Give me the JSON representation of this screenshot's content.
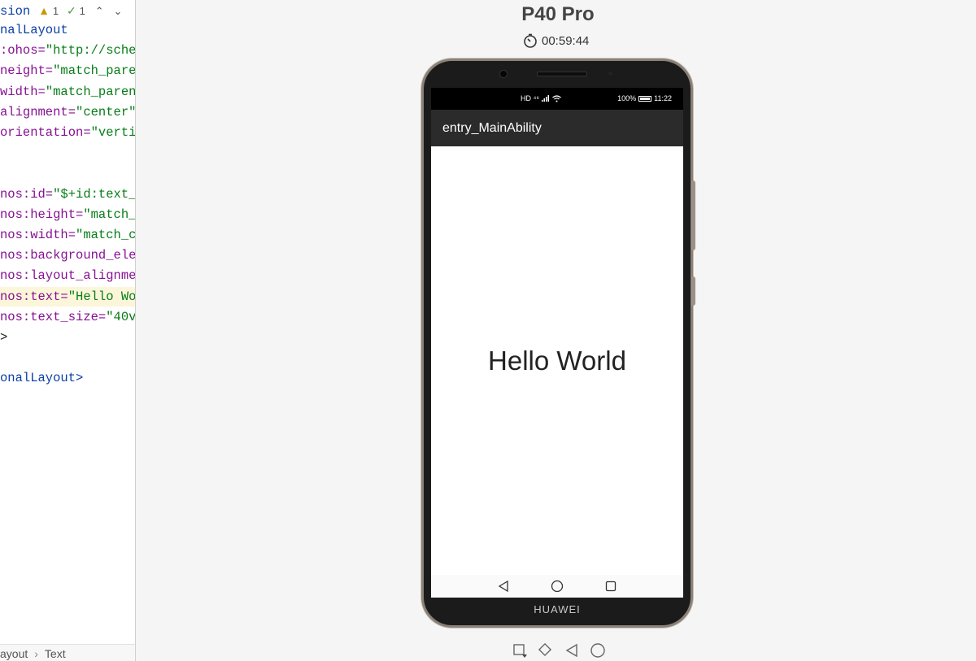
{
  "editor": {
    "status": {
      "context": "sion",
      "warnings": "1",
      "checks": "1"
    },
    "lines": [
      {
        "segments": [
          {
            "text": "nalLayout",
            "cls": "tag"
          }
        ]
      },
      {
        "segments": [
          {
            "text": ":ohos=",
            "cls": "attr"
          },
          {
            "text": "\"http://sche",
            "cls": "val"
          }
        ]
      },
      {
        "segments": [
          {
            "text": "neight=",
            "cls": "attr"
          },
          {
            "text": "\"match_pare",
            "cls": "val"
          }
        ]
      },
      {
        "segments": [
          {
            "text": "width=",
            "cls": "attr"
          },
          {
            "text": "\"match_paren",
            "cls": "val"
          }
        ]
      },
      {
        "segments": [
          {
            "text": "alignment=",
            "cls": "attr"
          },
          {
            "text": "\"center\"",
            "cls": "val"
          }
        ]
      },
      {
        "segments": [
          {
            "text": "orientation=",
            "cls": "attr"
          },
          {
            "text": "\"verti",
            "cls": "val"
          }
        ]
      },
      {
        "segments": []
      },
      {
        "segments": []
      },
      {
        "segments": [
          {
            "text": "nos:id=",
            "cls": "attr"
          },
          {
            "text": "\"$+id:text_",
            "cls": "val"
          }
        ]
      },
      {
        "segments": [
          {
            "text": "nos:height=",
            "cls": "attr"
          },
          {
            "text": "\"match_",
            "cls": "val"
          }
        ]
      },
      {
        "segments": [
          {
            "text": "nos:width=",
            "cls": "attr"
          },
          {
            "text": "\"match_c",
            "cls": "val"
          }
        ]
      },
      {
        "segments": [
          {
            "text": "nos:background_ele",
            "cls": "attr"
          }
        ]
      },
      {
        "segments": [
          {
            "text": "nos:layout_alignme",
            "cls": "attr"
          }
        ]
      },
      {
        "segments": [
          {
            "text": "nos:text=",
            "cls": "attr"
          },
          {
            "text": "\"Hello Wo",
            "cls": "val"
          }
        ],
        "highlight": true
      },
      {
        "segments": [
          {
            "text": "nos:text_size=",
            "cls": "attr"
          },
          {
            "text": "\"40v",
            "cls": "val"
          }
        ]
      },
      {
        "segments": [
          {
            "text": ">",
            "cls": "punct"
          }
        ]
      },
      {
        "segments": []
      },
      {
        "segments": [
          {
            "text": "onalLayout>",
            "cls": "tag"
          }
        ]
      }
    ],
    "breadcrumb": {
      "first": "ayout",
      "separator": "›",
      "second": "Text"
    }
  },
  "preview": {
    "device_name": "P40 Pro",
    "timer": "00:59:44",
    "status_left": "HD ⁴⁶",
    "battery": "100%",
    "time": "11:22",
    "app_title": "entry_MainAbility",
    "content_text": "Hello World",
    "brand": "HUAWEI"
  },
  "colors": {
    "attr": "#871094",
    "value": "#067d17",
    "tag": "#0a3fa6",
    "highlight": "#fbf6d9"
  }
}
